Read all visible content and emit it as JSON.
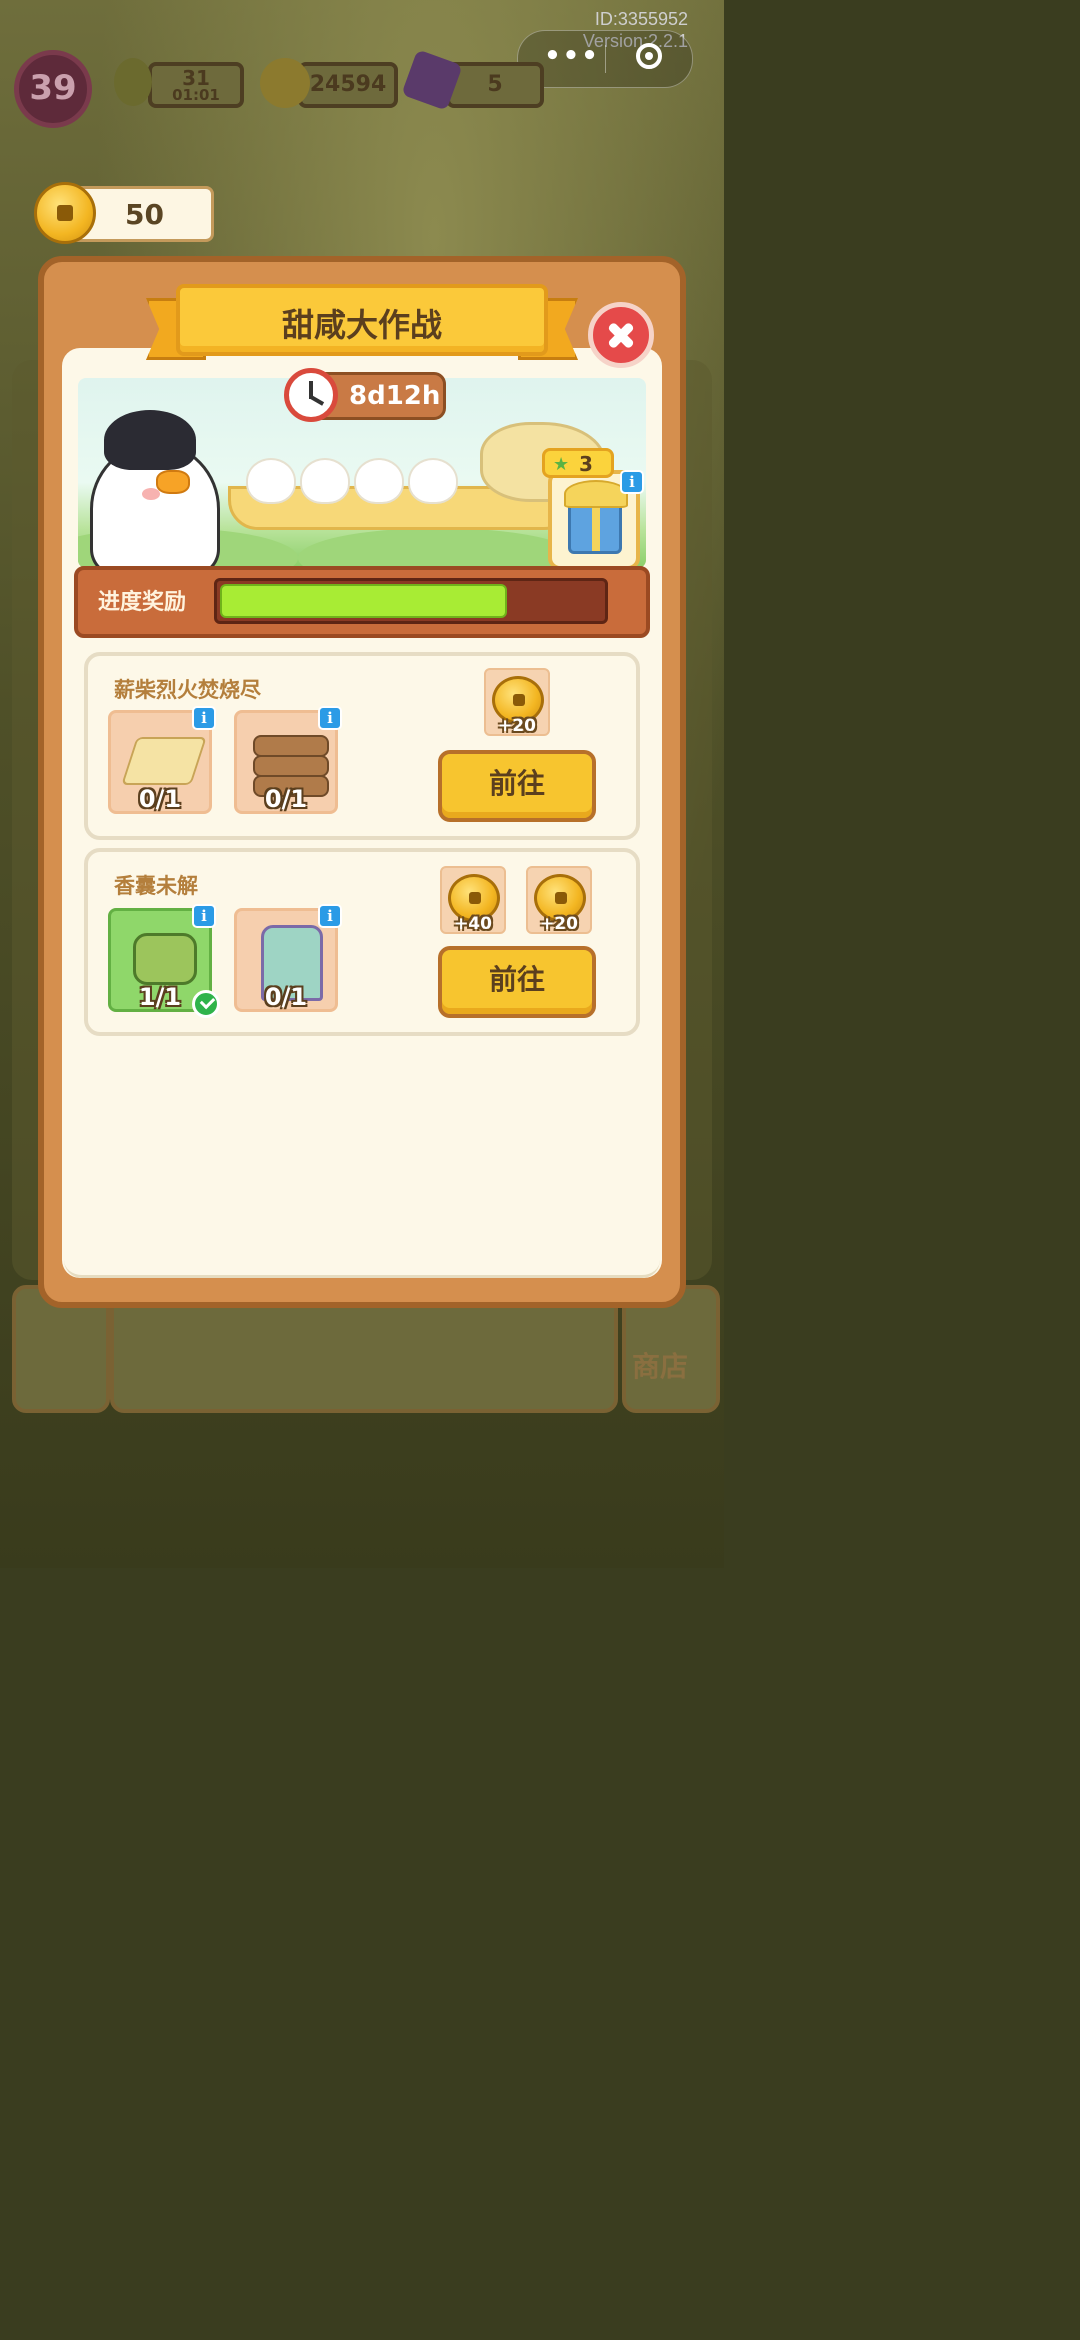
{
  "system": {
    "id_text": "ID:3355952",
    "version_text": "Version:2.2.1",
    "menu_dots": "•••"
  },
  "hud": {
    "level": "39",
    "energy": {
      "value": "31",
      "timer": "01:01"
    },
    "coins": "24594",
    "gems": "5",
    "event_coins": "50"
  },
  "dialog": {
    "title": "甜咸大作战",
    "timer": "8d12h",
    "gift_stars": "3",
    "progress_label": "进度奖励",
    "progress_fraction": 0.75,
    "info_glyph": "i",
    "tasks": [
      {
        "title": "薪柴烈火焚烧尽",
        "items": [
          {
            "count": "0/1",
            "done": false
          },
          {
            "count": "0/1",
            "done": false
          }
        ],
        "rewards": [
          "+20"
        ],
        "button": "前往"
      },
      {
        "title": "香囊未解",
        "items": [
          {
            "count": "1/1",
            "done": true
          },
          {
            "count": "0/1",
            "done": false
          }
        ],
        "rewards": [
          "+40",
          "+20"
        ],
        "button": "前往"
      }
    ]
  },
  "background": {
    "shop_label": "商店"
  },
  "colors": {
    "accent": "#f7c52f",
    "progress": "#a8ec34",
    "close": "#e54a4a"
  }
}
